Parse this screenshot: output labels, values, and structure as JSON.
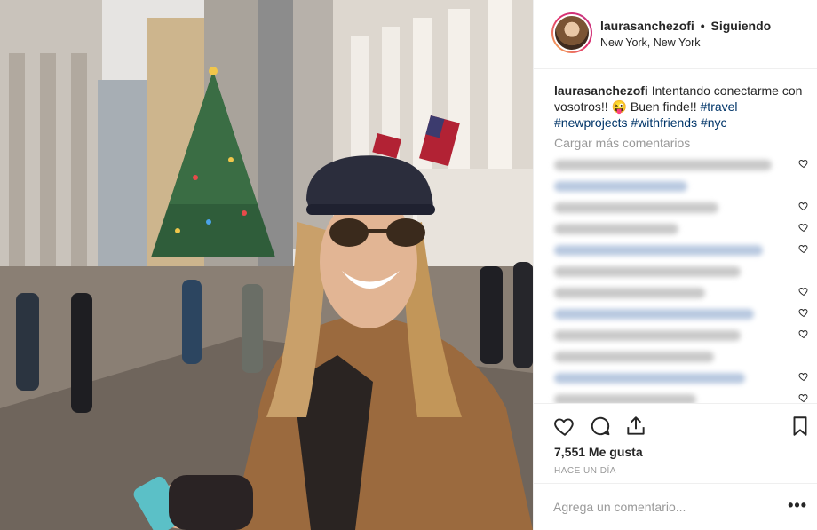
{
  "post": {
    "username": "laurasanchezofi",
    "follow_status": "Siguiendo",
    "separator": "•",
    "location": "New York, New York"
  },
  "caption": {
    "username": "laurasanchezofi",
    "text": "Intentando conectarme con vosotros!! 😜 Buen finde!!",
    "hashtags": [
      "#travel",
      "#newprojects",
      "#withfriends",
      "#nyc"
    ]
  },
  "comments": {
    "load_more_label": "Cargar más comentarios",
    "blurred_count": 12
  },
  "actions": {
    "likes_text": "7,551 Me gusta",
    "timestamp": "HACE UN DÍA"
  },
  "comment_box": {
    "placeholder": "Agrega un comentario...",
    "more_label": "•••"
  },
  "icons": [
    "heart-icon",
    "comment-icon",
    "share-icon",
    "bookmark-icon",
    "more-options-icon"
  ],
  "colors": {
    "hashtag": "#003569",
    "muted": "#999999",
    "border": "#efefef",
    "story_ring_start": "#f9c153",
    "story_ring_end": "#c13584"
  }
}
